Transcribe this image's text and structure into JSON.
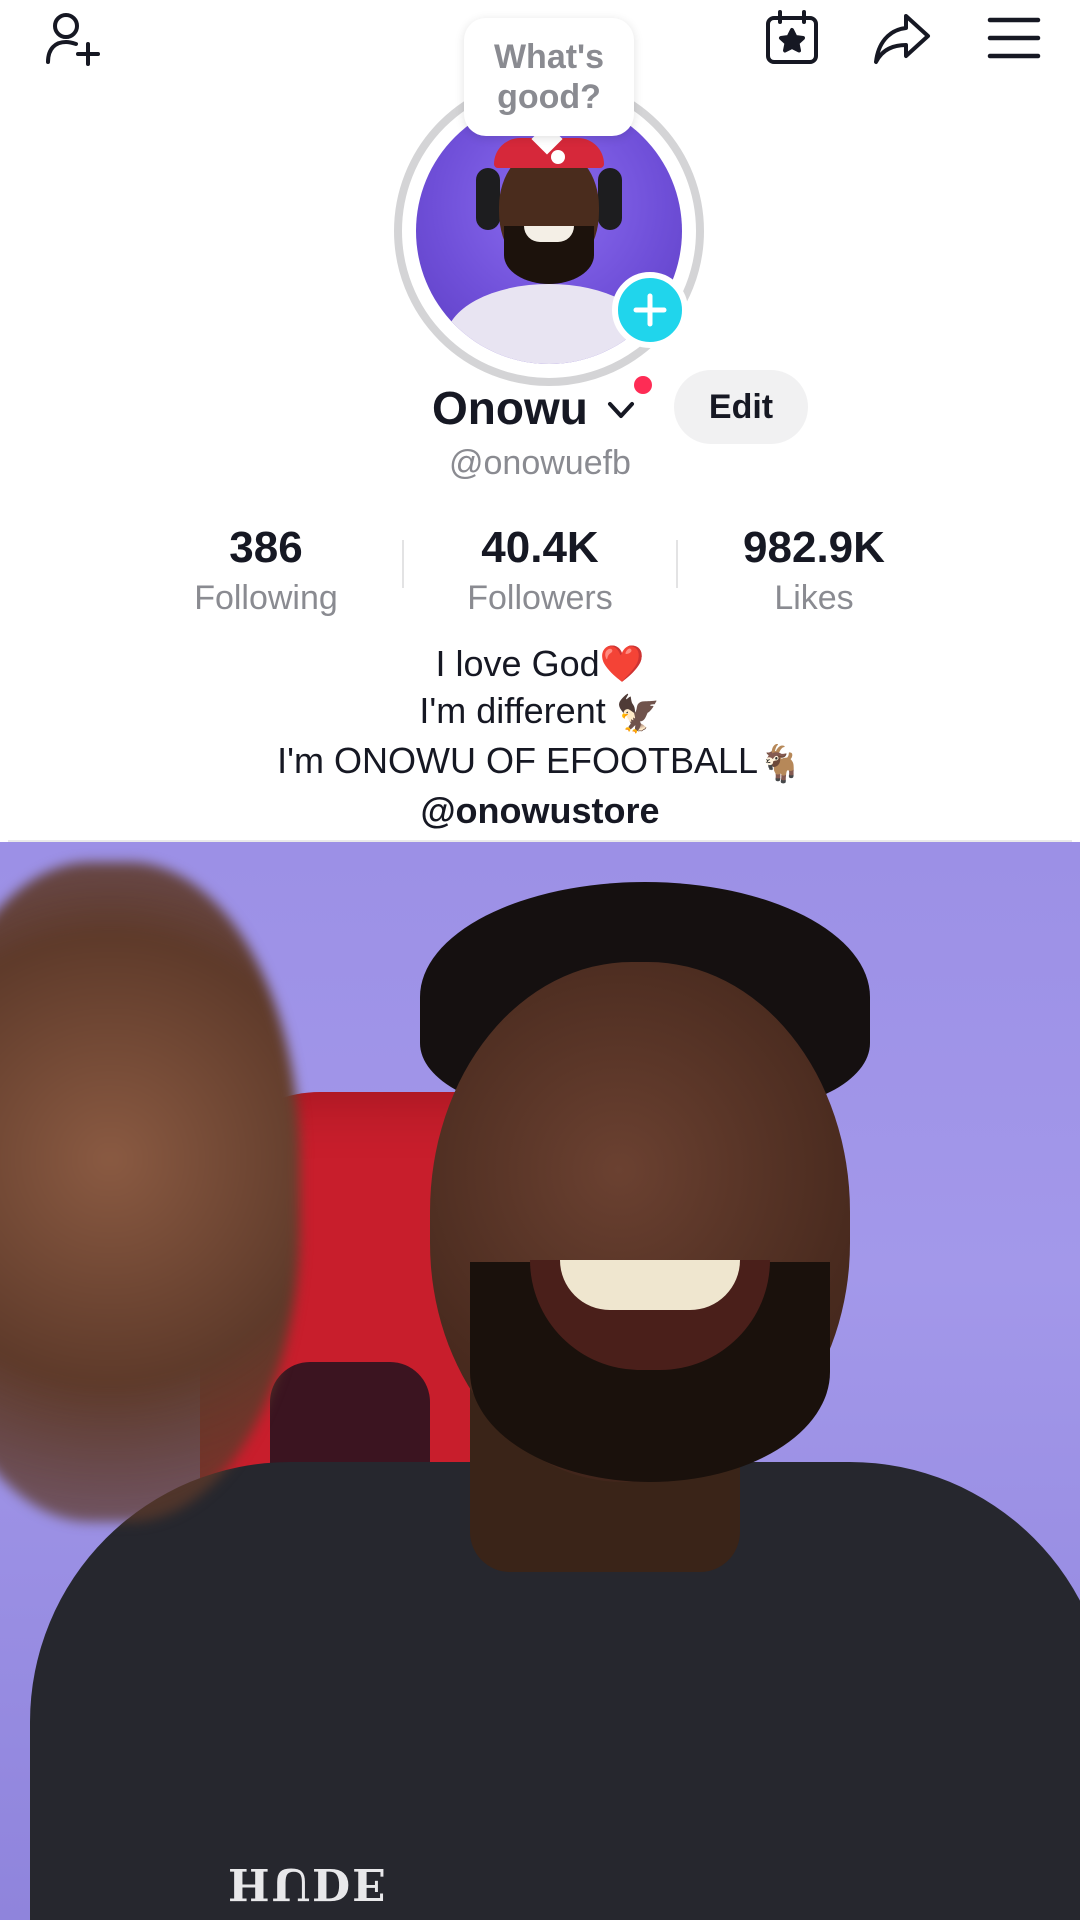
{
  "header": {
    "add_user_icon": "add-user-icon",
    "calendar_icon": "calendar-star-icon",
    "share_icon": "share-arrow-icon",
    "menu_icon": "hamburger-menu-icon"
  },
  "status_bubble": {
    "text": "What's good?"
  },
  "profile": {
    "display_name": "Onowu",
    "username": "@onowuefb",
    "edit_label": "Edit",
    "avatar_plus_color": "#20d5ec",
    "notification_dot_color": "#fe2c55"
  },
  "stats": [
    {
      "value": "386",
      "label": "Following"
    },
    {
      "value": "40.4K",
      "label": "Followers"
    },
    {
      "value": "982.9K",
      "label": "Likes"
    }
  ],
  "bio": {
    "line1": "I love God",
    "line1_emoji": "❤️",
    "line2": "I'm different",
    "line2_emoji": "🦅",
    "line3": "I'm ONOWU OF EFOOTBALL",
    "line3_emoji": "🐐",
    "link": "@onowustore"
  },
  "video": {
    "shirt_text": "HUDE"
  }
}
